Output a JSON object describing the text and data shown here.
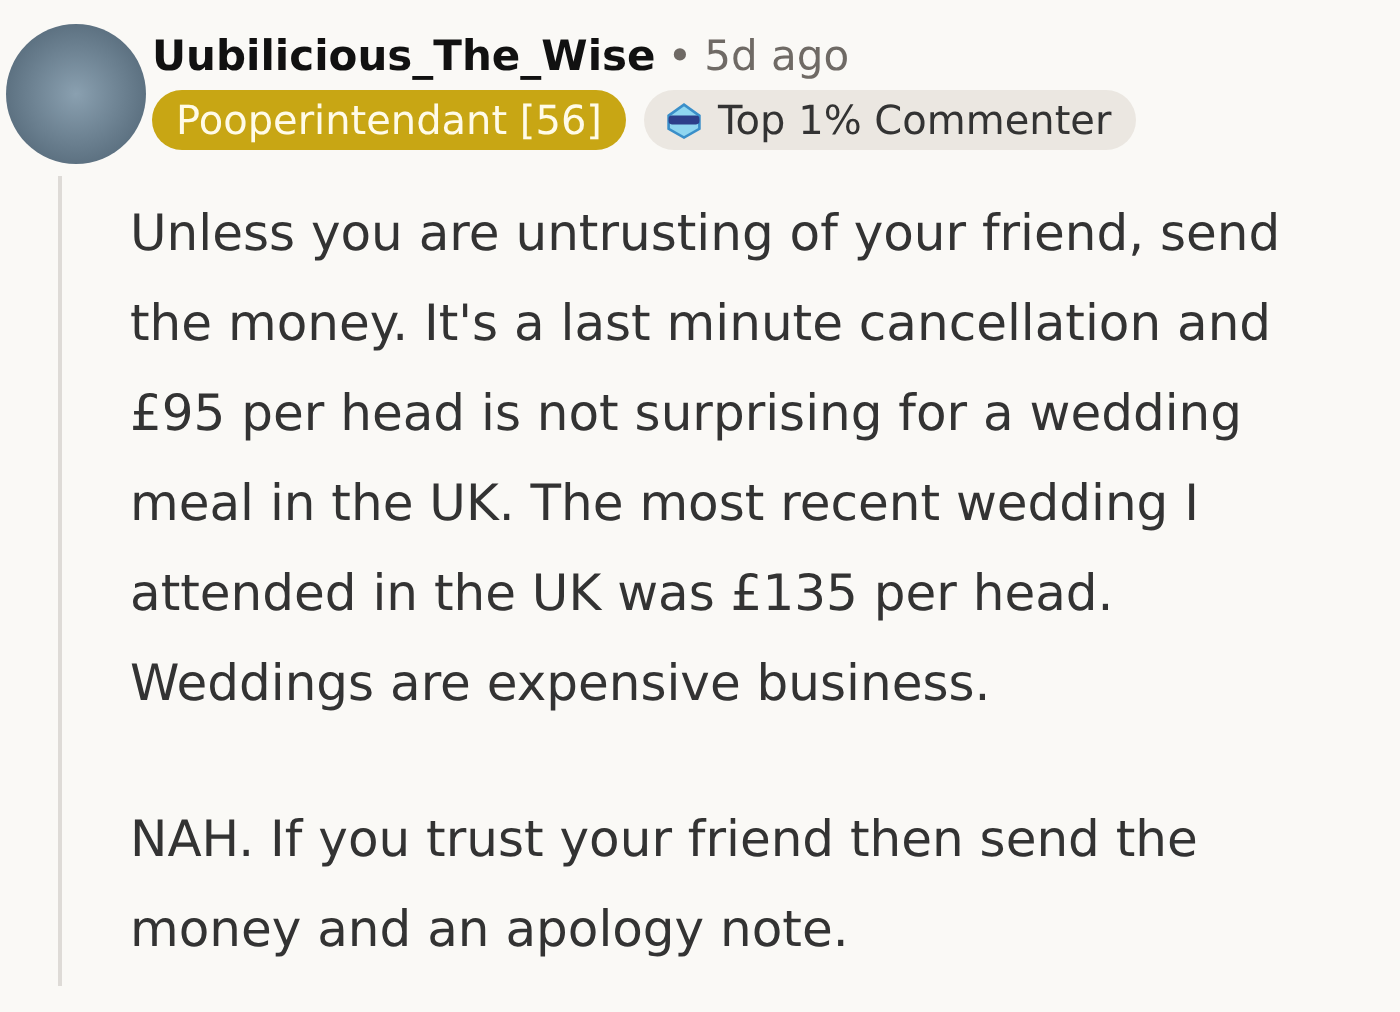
{
  "comment": {
    "author": "Uubilicious_The_Wise",
    "separator": "•",
    "time": "5d ago",
    "flair": "Pooperintendant [56]",
    "badge": "Top 1% Commenter",
    "paragraphs": [
      "Unless you are untrusting of your friend, send the money. It's a last minute cancellation and £95 per head is not surprising for a wedding meal in the UK. The most recent wedding I attended in the UK was £135 per head. Weddings are expensive business.",
      "NAH. If you trust your friend then send the money and an apology note."
    ]
  }
}
